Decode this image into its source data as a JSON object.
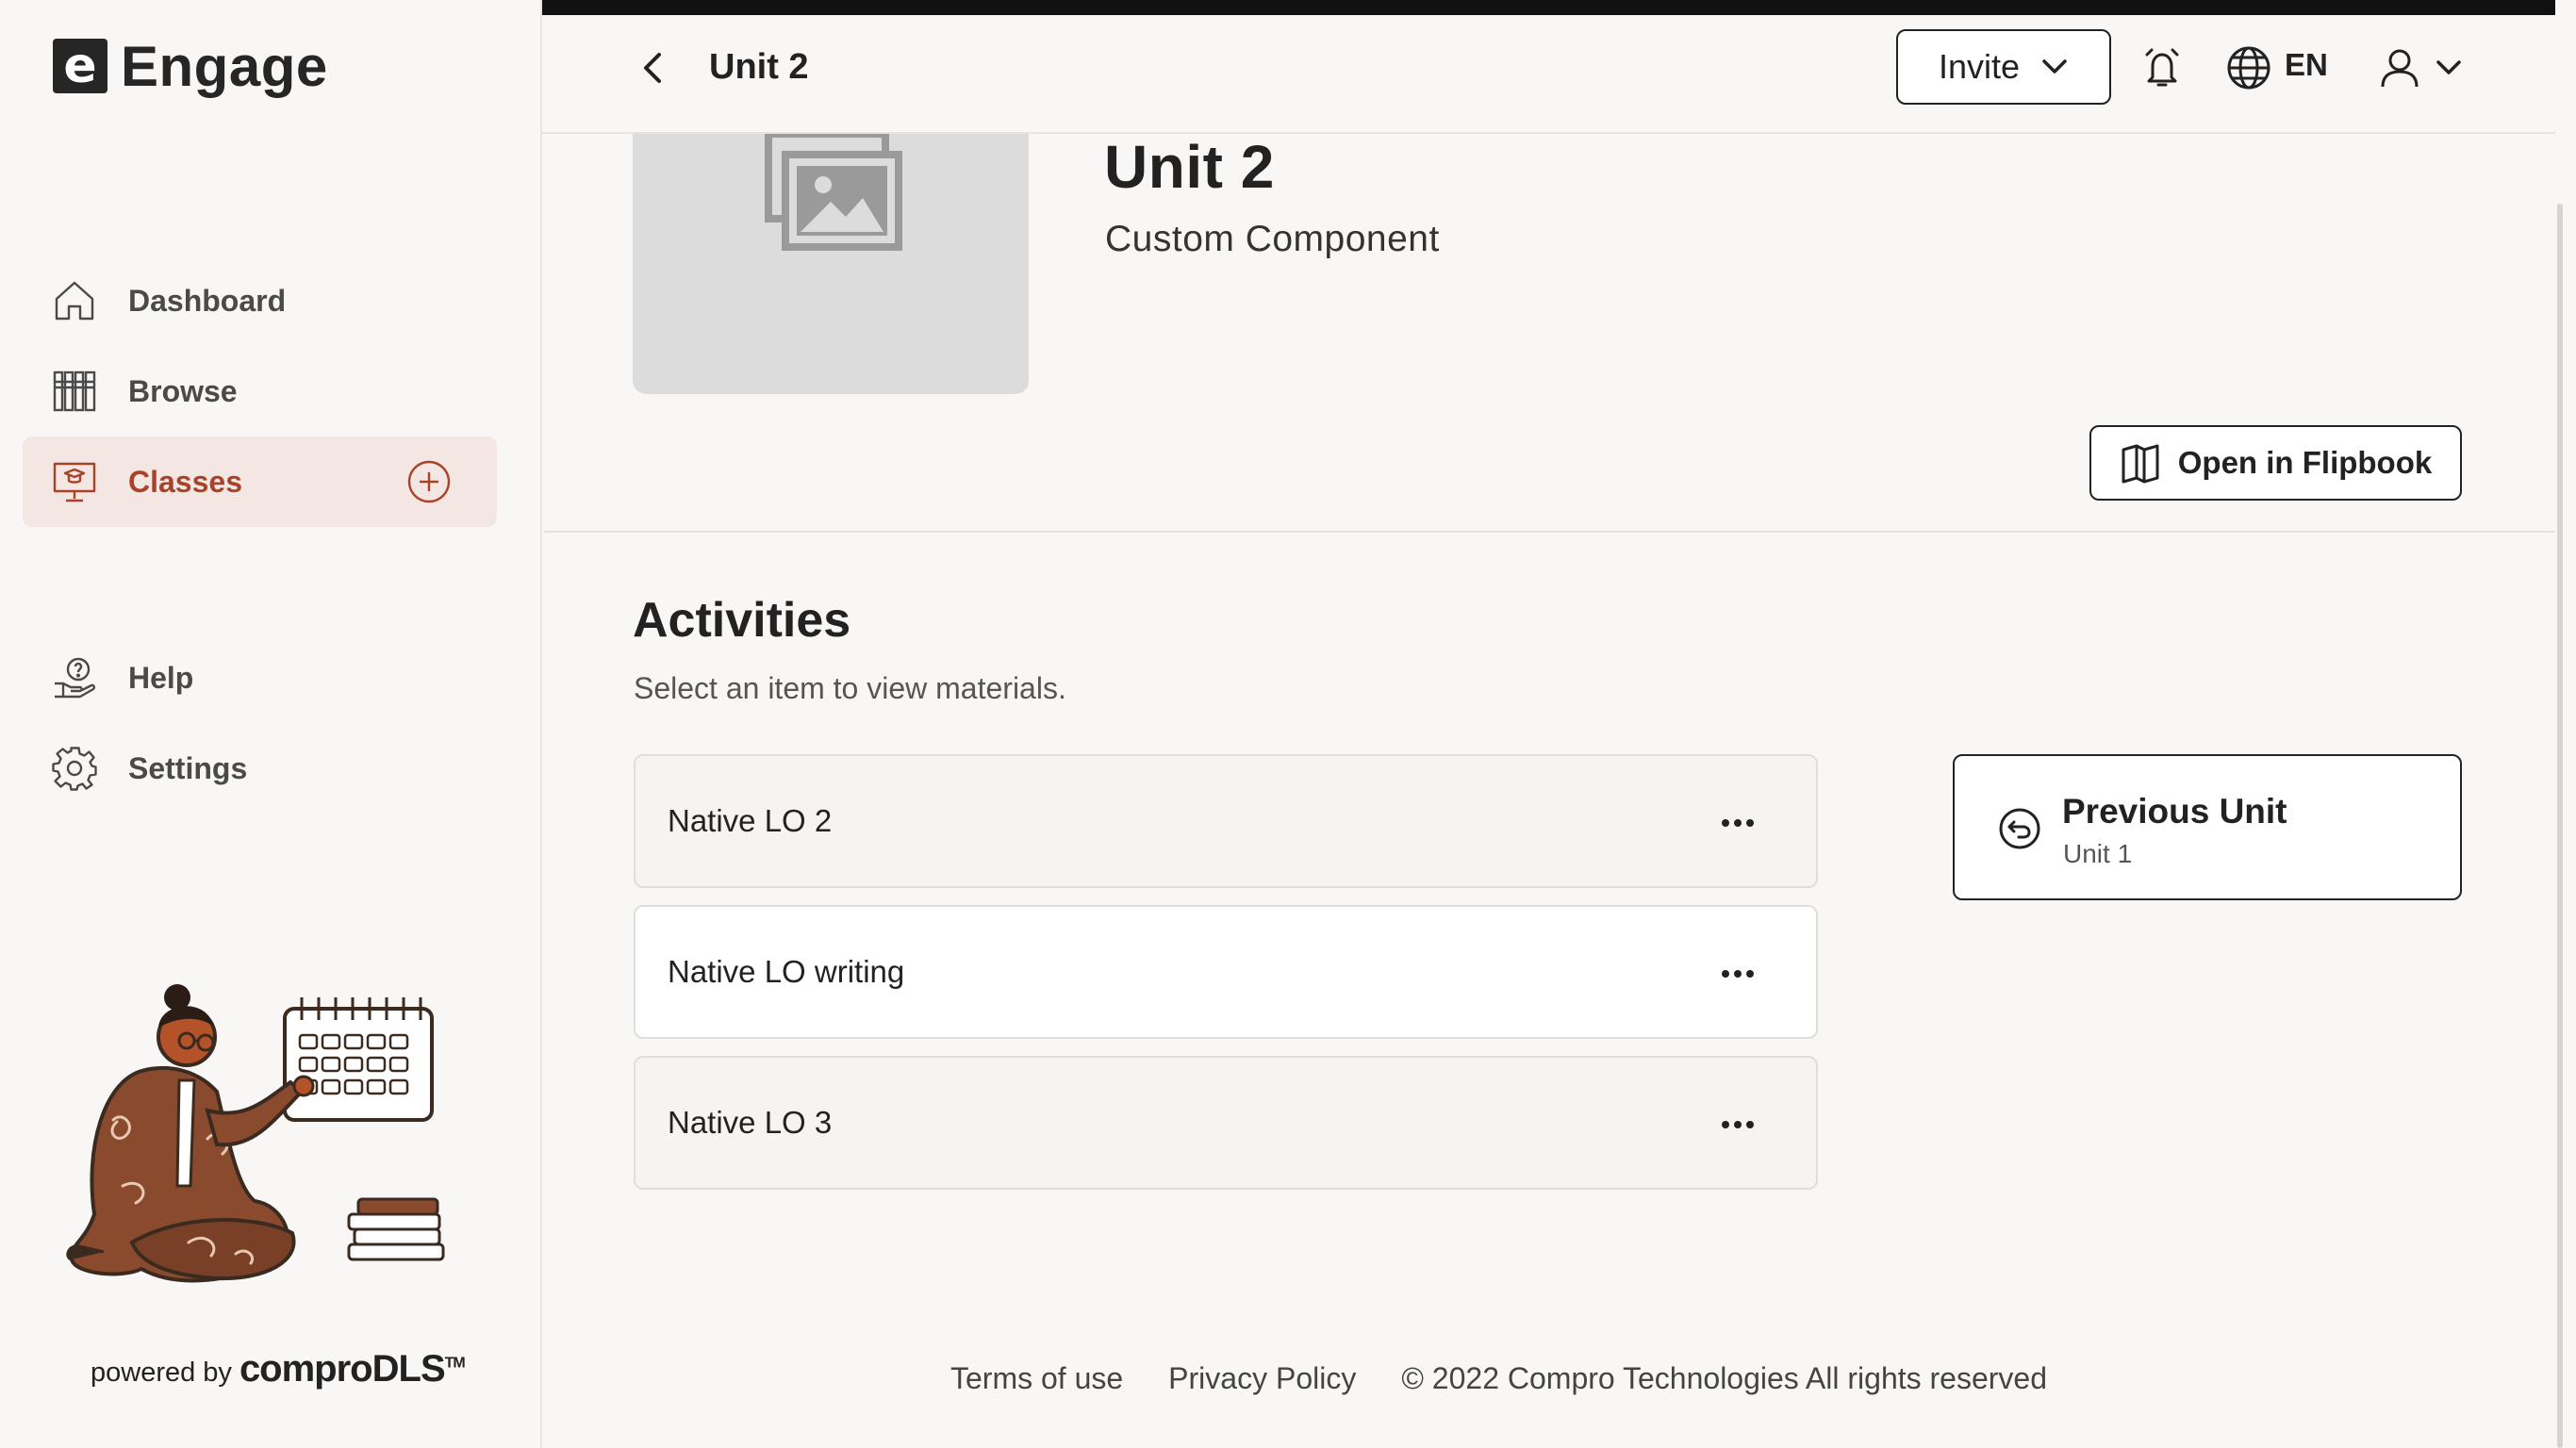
{
  "brand": {
    "logo_letter": "e",
    "name": "Engage"
  },
  "sidebar": {
    "items": [
      {
        "label": "Dashboard",
        "icon": "home-icon"
      },
      {
        "label": "Browse",
        "icon": "books-icon"
      },
      {
        "label": "Classes",
        "icon": "classroom-icon",
        "active": true
      },
      {
        "label": "Help",
        "icon": "help-icon"
      },
      {
        "label": "Settings",
        "icon": "gear-icon"
      }
    ],
    "powered_by": "powered by",
    "powered_brand": "comproDLS",
    "powered_tm": "TM"
  },
  "header": {
    "title": "Unit 2",
    "invite_label": "Invite",
    "language": "EN"
  },
  "unit": {
    "title": "Unit 2",
    "subtitle": "Custom Component",
    "flipbook_label": "Open in Flipbook"
  },
  "activities": {
    "title": "Activities",
    "subtitle": "Select an item to view materials.",
    "items": [
      {
        "label": "Native LO 2"
      },
      {
        "label": "Native LO writing"
      },
      {
        "label": "Native LO 3"
      }
    ]
  },
  "previous_unit": {
    "title": "Previous Unit",
    "subtitle": "Unit 1"
  },
  "footer": {
    "terms": "Terms of use",
    "privacy": "Privacy Policy",
    "copyright": "© 2022 Compro Technologies All rights reserved"
  },
  "colors": {
    "accent": "#a8432a",
    "active_bg": "#f4e6e2",
    "page_bg": "#f8f7f6",
    "dark": "#222222"
  }
}
